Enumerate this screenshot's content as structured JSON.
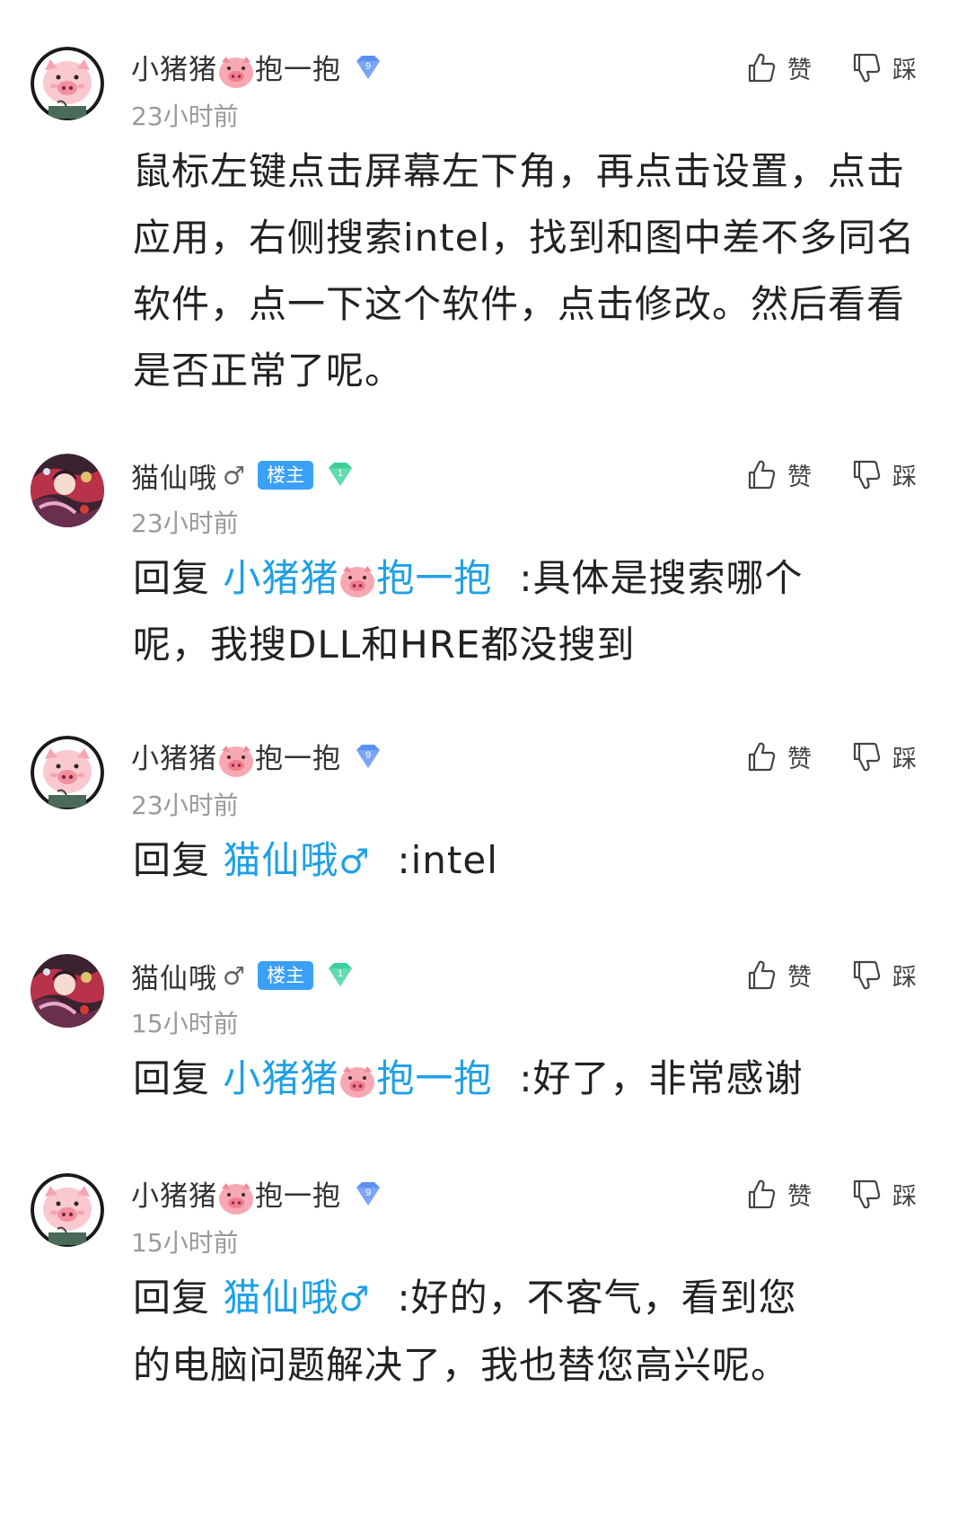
{
  "actions": {
    "like_label": "赞",
    "dislike_label": "踩"
  },
  "comments": [
    {
      "username_part1": "小猪猪",
      "username_part2": "抱一抱",
      "level": "9",
      "time": "23小时前",
      "text": "鼠标左键点击屏幕左下角，再点击设置，点击应用，右侧搜索intel，找到和图中差不多同名软件，点一下这个软件，点击修改。然后看看是否正常了呢。"
    },
    {
      "username": "猫仙哦",
      "gender_symbol": "♂",
      "host_badge": "楼主",
      "level": "1",
      "time": "23小时前",
      "reply_prefix": "回复",
      "mention_part1": "小猪猪",
      "mention_part2": "抱一抱",
      "text_line1": ":具体是搜索哪个",
      "text_line2": "呢，我搜DLL和HRE都没搜到"
    },
    {
      "username_part1": "小猪猪",
      "username_part2": "抱一抱",
      "level": "9",
      "time": "23小时前",
      "reply_prefix": "回复",
      "mention": "猫仙哦",
      "mention_symbol": "♂",
      "text": ":intel"
    },
    {
      "username": "猫仙哦",
      "gender_symbol": "♂",
      "host_badge": "楼主",
      "level": "1",
      "time": "15小时前",
      "reply_prefix": "回复",
      "mention_part1": "小猪猪",
      "mention_part2": "抱一抱",
      "text": ":好了，非常感谢"
    },
    {
      "username_part1": "小猪猪",
      "username_part2": "抱一抱",
      "level": "9",
      "time": "15小时前",
      "reply_prefix": "回复",
      "mention": "猫仙哦",
      "mention_symbol": "♂",
      "text_line1": ":好的，不客气，看到您",
      "text_line2": "的电脑问题解决了，我也替您高兴呢。"
    }
  ],
  "colors": {
    "mention": "#1ea0e6",
    "host_badge": "#3aa0f5",
    "level_9": "#5b8ff0",
    "level_1": "#3ccf9a",
    "timestamp": "#9a9a9a"
  },
  "icons": [
    "pig-avatar-icon",
    "anime-avatar-icon",
    "pig-emoji-icon",
    "level-badge-icon",
    "thumbs-up-icon",
    "thumbs-down-icon"
  ]
}
